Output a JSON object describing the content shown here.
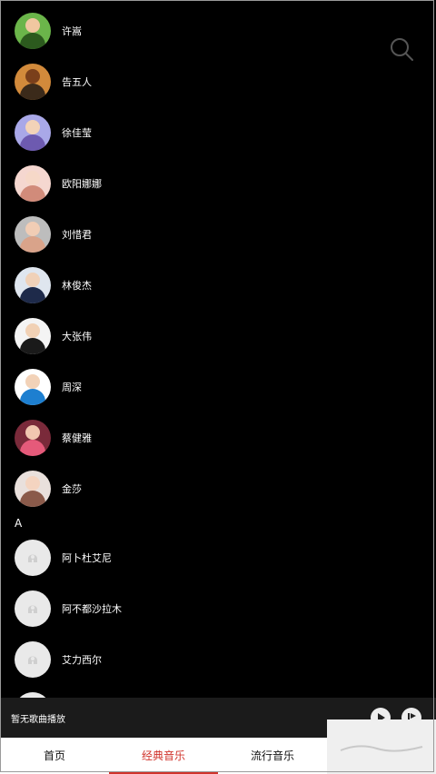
{
  "artists": [
    {
      "name": "许嵩",
      "avatar": "photo",
      "colors": [
        "#6bb54a",
        "#f0c7a0",
        "#2c5a1e"
      ]
    },
    {
      "name": "告五人",
      "avatar": "photo",
      "colors": [
        "#d28a3b",
        "#7a3f1b",
        "#3b2a1a"
      ]
    },
    {
      "name": "徐佳莹",
      "avatar": "photo",
      "colors": [
        "#a9a8e8",
        "#f3d3b8",
        "#6d5ab0"
      ]
    },
    {
      "name": "欧阳娜娜",
      "avatar": "photo",
      "colors": [
        "#f5d7d0",
        "#f6d8c8",
        "#d18b7a"
      ]
    },
    {
      "name": "刘惜君",
      "avatar": "photo",
      "colors": [
        "#bdbdbd",
        "#f1cdb5",
        "#d9a38a"
      ]
    },
    {
      "name": "林俊杰",
      "avatar": "photo",
      "colors": [
        "#dfe6ef",
        "#f0d1b8",
        "#1e2a4a"
      ]
    },
    {
      "name": "大张伟",
      "avatar": "photo",
      "colors": [
        "#f4f4f4",
        "#f1d1b5",
        "#1a1a1a"
      ]
    },
    {
      "name": "周深",
      "avatar": "photo",
      "colors": [
        "#ffffff",
        "#f2d2b8",
        "#1d7fd0"
      ]
    },
    {
      "name": "蔡健雅",
      "avatar": "photo",
      "colors": [
        "#7a2a3a",
        "#f1c6b0",
        "#e55a7a"
      ]
    },
    {
      "name": "金莎",
      "avatar": "photo",
      "colors": [
        "#e9e0dc",
        "#f4d4c0",
        "#8a5a4a"
      ]
    }
  ],
  "section_letter": "A",
  "artists_a": [
    {
      "name": "阿卜杜艾尼"
    },
    {
      "name": "阿不都沙拉木"
    },
    {
      "name": "艾力西尔"
    }
  ],
  "player": {
    "status_text": "暂无歌曲播放",
    "play_icon": "play-icon",
    "list_icon": "playlist-icon"
  },
  "tabs": [
    {
      "label": "首页",
      "active": false
    },
    {
      "label": "经典音乐",
      "active": true
    },
    {
      "label": "流行音乐",
      "active": false
    }
  ],
  "accent_color": "#d0342c"
}
